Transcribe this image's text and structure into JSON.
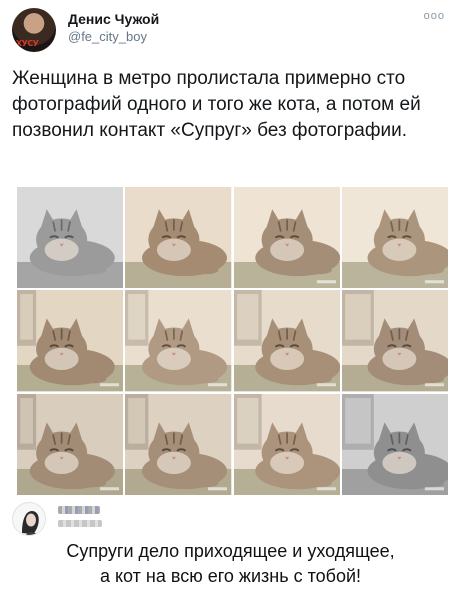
{
  "tweet": {
    "author_name": "Денис Чужой",
    "author_handle": "@fe_city_boy",
    "avatar_text": "ХУСУ",
    "more_icon": "more-dots-icon",
    "text": "Женщина в метро пролистала примерно сто фотографий одного и того же кота, а потом ей позвонил контакт «Супруг» без фотографии."
  },
  "photos": [
    {
      "name": "cat-photo-1",
      "tone": "bw",
      "bg": "#d9d9d9",
      "fur": "#9b9b9b",
      "dark": "#555555"
    },
    {
      "name": "cat-photo-2",
      "tone": "warm",
      "bg": "#e9dccb",
      "fur": "#a58b72",
      "dark": "#5b4a3c"
    },
    {
      "name": "cat-photo-3",
      "tone": "warm",
      "bg": "#efe4d3",
      "fur": "#a48e77",
      "dark": "#5c4b3b"
    },
    {
      "name": "cat-photo-4",
      "tone": "warm",
      "bg": "#efe6d8",
      "fur": "#ab957d",
      "dark": "#5e4d3e"
    },
    {
      "name": "cat-photo-5",
      "tone": "warm",
      "bg": "#e3d7c4",
      "fur": "#a28a72",
      "dark": "#57473a"
    },
    {
      "name": "cat-photo-6",
      "tone": "warm",
      "bg": "#eadfcf",
      "fur": "#b09a83",
      "dark": "#5f4f40"
    },
    {
      "name": "cat-photo-7",
      "tone": "warm",
      "bg": "#e7dccb",
      "fur": "#a89078",
      "dark": "#5b4b3c"
    },
    {
      "name": "cat-photo-8",
      "tone": "warm",
      "bg": "#e4d8c8",
      "fur": "#a38d79",
      "dark": "#5a4a3d"
    },
    {
      "name": "cat-photo-9",
      "tone": "warm",
      "bg": "#d9cdbd",
      "fur": "#a28c76",
      "dark": "#574739"
    },
    {
      "name": "cat-photo-10",
      "tone": "warm",
      "bg": "#ddd1c1",
      "fur": "#a58f78",
      "dark": "#58483a"
    },
    {
      "name": "cat-photo-11",
      "tone": "warm",
      "bg": "#e6dbcc",
      "fur": "#ab937c",
      "dark": "#5d4c3e"
    },
    {
      "name": "cat-photo-12",
      "tone": "bw",
      "bg": "#cfcfcf",
      "fur": "#8f8f8f",
      "dark": "#4d4d4d"
    }
  ],
  "reply": {
    "text_line1": "Супруги дело приходящее и уходящее,",
    "text_line2": "а кот на всю его жизнь с тобой!"
  }
}
